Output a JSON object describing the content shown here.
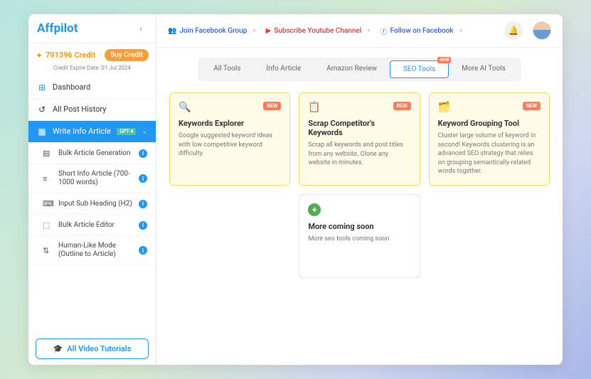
{
  "brand": "Affpilot",
  "credit": {
    "amount": "791396 Credit",
    "buy_label": "Buy Credit",
    "expire": "Credit Expire Date: 01 Jul 2024"
  },
  "nav": {
    "dashboard": "Dashboard",
    "history": "All Post History",
    "write": "Write Info Article",
    "write_badge": "GPT-4",
    "subs": [
      "Bulk Article Generation",
      "Short Info Article (700-1000 words)",
      "Input Sub Heading (H2)",
      "Bulk Article Editor",
      "Human-Like Mode (Outline to Article)"
    ]
  },
  "tutorials_label": "All Video Tutorials",
  "topbar": {
    "fbgroup": "Join Facebook Group",
    "youtube": "Subscribe Youtube Channel",
    "facebook": "Follow on Facebook"
  },
  "tabs": [
    "All Tools",
    "Info Article",
    "Amazon Review",
    "SEO Tools",
    "More AI Tools"
  ],
  "tab_new": "NEW",
  "cards": [
    {
      "title": "Keywords Explorer",
      "desc": "Google suggested keyword ideas with low competitive keyword difficulty",
      "new": "NEW"
    },
    {
      "title": "Scrap Competitor's Keywords",
      "desc": "Scrap all keywords and post titles from any website. Clone any website in minutes.",
      "new": "NEW"
    },
    {
      "title": "Keyword Grouping Tool",
      "desc": "Cluster large volume of keyword in second! Keywords clustering is an advanced SEO strategy that relies on grouping semantically-related words together.",
      "new": "NEW"
    }
  ],
  "coming": {
    "title": "More coming soon",
    "desc": "More seo tools coming soon"
  }
}
